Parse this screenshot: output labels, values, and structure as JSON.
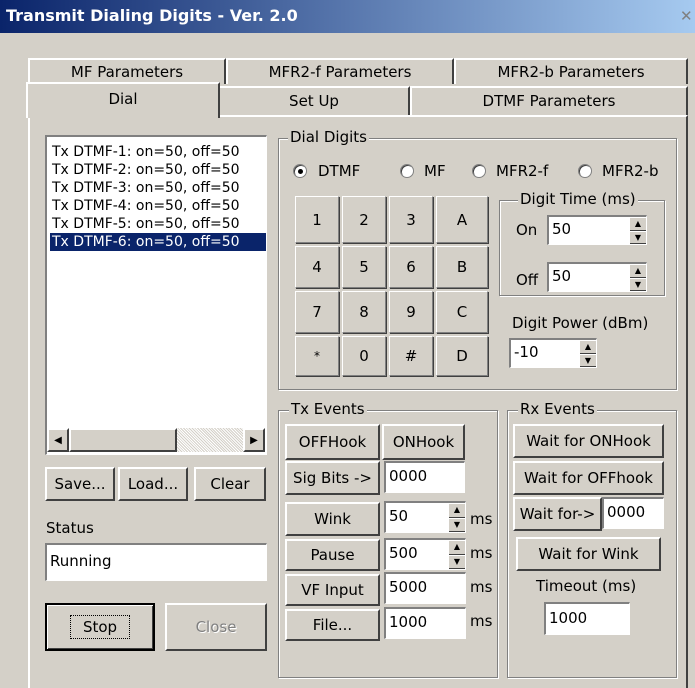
{
  "window": {
    "title": "Transmit Dialing Digits - Ver. 2.0",
    "close_glyph": "✕"
  },
  "tabs": {
    "row_top": [
      "MF Parameters",
      "MFR2-f Parameters",
      "MFR2-b Parameters"
    ],
    "row_bottom": [
      "Dial",
      "Set Up",
      "DTMF Parameters"
    ],
    "active": "Dial"
  },
  "sequence_list": {
    "items": [
      "Tx DTMF-1: on=50, off=50",
      "Tx DTMF-2: on=50, off=50",
      "Tx DTMF-3: on=50, off=50",
      "Tx DTMF-4: on=50, off=50",
      "Tx DTMF-5: on=50, off=50",
      "Tx DTMF-6: on=50, off=50"
    ],
    "selected_index": 5
  },
  "list_buttons": {
    "save": "Save...",
    "load": "Load...",
    "clear": "Clear"
  },
  "status": {
    "label": "Status",
    "value": "Running"
  },
  "bottom_buttons": {
    "stop": "Stop",
    "close": "Close"
  },
  "dial_digits": {
    "label": "Dial Digits",
    "modes": [
      "DTMF",
      "MF",
      "MFR2-f",
      "MFR2-b"
    ],
    "selected_mode": "DTMF",
    "keys": [
      [
        "1",
        "2",
        "3",
        "A"
      ],
      [
        "4",
        "5",
        "6",
        "B"
      ],
      [
        "7",
        "8",
        "9",
        "C"
      ],
      [
        "*",
        "0",
        "#",
        "D"
      ]
    ],
    "digit_time": {
      "label": "Digit Time (ms)",
      "on_label": "On",
      "on_value": "50",
      "off_label": "Off",
      "off_value": "50"
    },
    "digit_power": {
      "label": "Digit Power (dBm)",
      "value": "-10"
    }
  },
  "tx_events": {
    "label": "Tx Events",
    "offhook": "OFFHook",
    "onhook": "ONHook",
    "sig_bits": "Sig Bits ->",
    "sig_bits_value": "0000",
    "wink": "Wink",
    "wink_value": "50",
    "pause": "Pause",
    "pause_value": "500",
    "vf_input": "VF Input",
    "vf_input_value": "5000",
    "file": "File...",
    "file_value": "1000",
    "unit": "ms"
  },
  "rx_events": {
    "label": "Rx Events",
    "wait_onhook": "Wait for ONHook",
    "wait_offhook": "Wait for OFFhook",
    "wait_for": "Wait for->",
    "wait_for_value": "0000",
    "wait_wink": "Wait for Wink",
    "timeout_label": "Timeout (ms)",
    "timeout_value": "1000"
  }
}
